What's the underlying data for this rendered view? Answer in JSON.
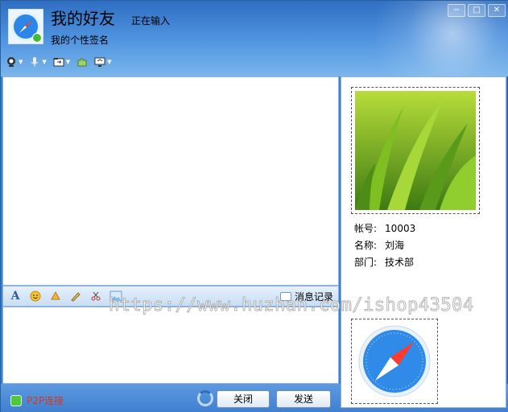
{
  "header": {
    "contact_name": "我的好友",
    "typing_status": "正在输入",
    "signature": "我的个性签名"
  },
  "toolbar": {
    "icons": [
      "webcam-icon",
      "microphone-icon",
      "folder-icon",
      "puzzle-icon",
      "screen-share-icon"
    ]
  },
  "format_bar": {
    "icons": [
      "font-icon",
      "emoji-icon",
      "shake-icon",
      "brush-icon",
      "scissors-icon",
      "image-icon"
    ],
    "history_label": "消息记录"
  },
  "bottom": {
    "p2p_label": "P2P连接",
    "close_label": "关闭",
    "send_label": "发送"
  },
  "profile": {
    "account_label": "帐号:",
    "account_value": "10003",
    "name_label": "名称:",
    "name_value": "刘海",
    "dept_label": "部门:",
    "dept_value": "技术部"
  },
  "watermark": "https://www.huzhan.com/ishop43504"
}
